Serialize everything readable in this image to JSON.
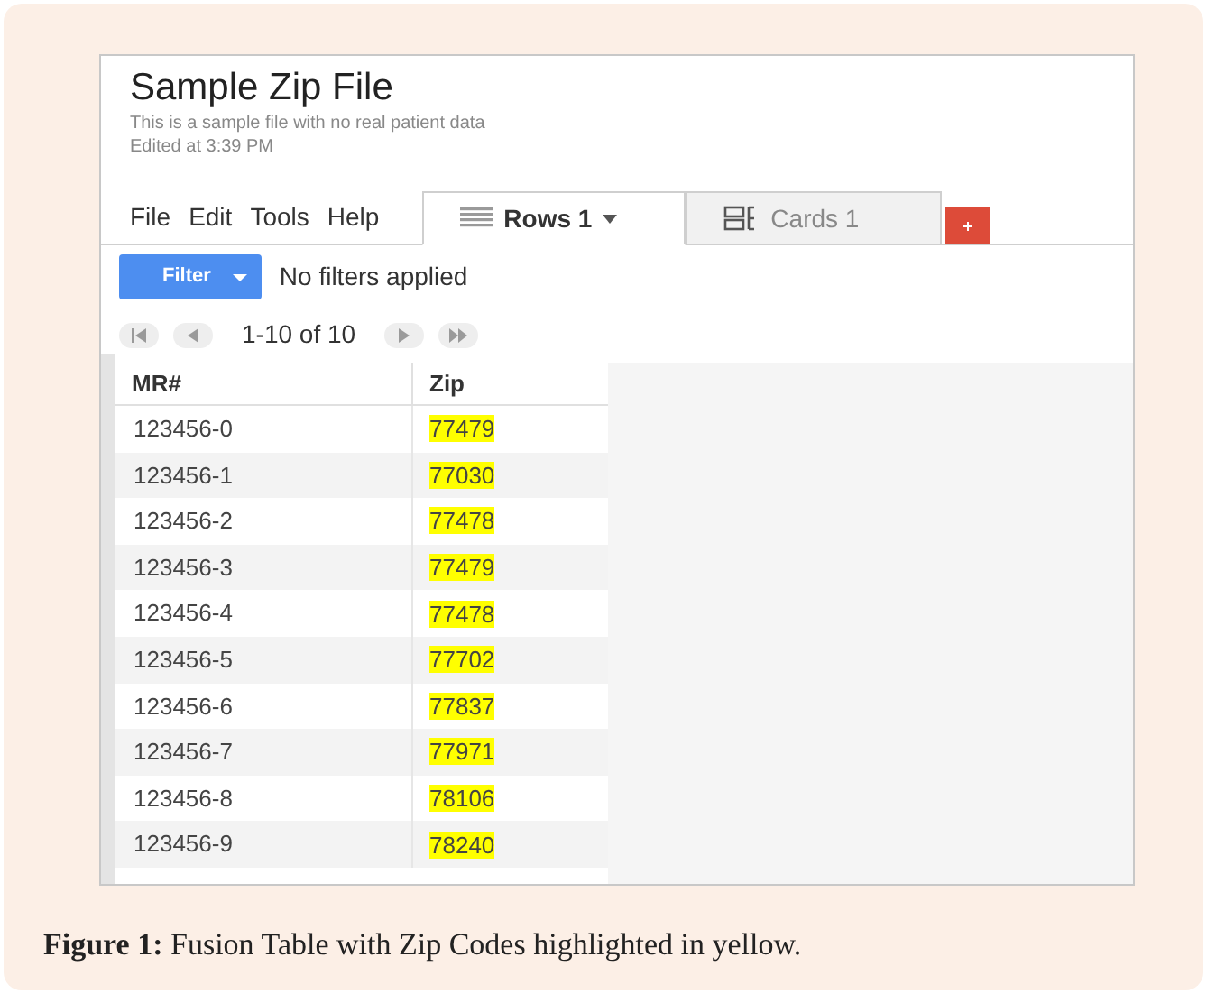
{
  "document": {
    "title": "Sample Zip File",
    "description": "This is a sample file with no real patient data",
    "edited": "Edited at 3:39 PM"
  },
  "menu": [
    "File",
    "Edit",
    "Tools",
    "Help"
  ],
  "tabs": [
    {
      "label": "Rows 1",
      "kind": "rows",
      "selected": true
    },
    {
      "label": "Cards 1",
      "kind": "cards",
      "selected": false
    }
  ],
  "filter": {
    "button": "Filter",
    "status": "No filters applied"
  },
  "pager": {
    "range": "1-10 of 10"
  },
  "table": {
    "columns": [
      "MR#",
      "Zip"
    ],
    "rows": [
      {
        "mr": "123456-0",
        "zip": "77479",
        "highlighted": true
      },
      {
        "mr": "123456-1",
        "zip": "77030",
        "highlighted": true
      },
      {
        "mr": "123456-2",
        "zip": "77478",
        "highlighted": true
      },
      {
        "mr": "123456-3",
        "zip": "77479",
        "highlighted": true
      },
      {
        "mr": "123456-4",
        "zip": "77478",
        "highlighted": true
      },
      {
        "mr": "123456-5",
        "zip": "77702",
        "highlighted": true
      },
      {
        "mr": "123456-6",
        "zip": "77837",
        "highlighted": true
      },
      {
        "mr": "123456-7",
        "zip": "77971",
        "highlighted": true
      },
      {
        "mr": "123456-8",
        "zip": "78106",
        "highlighted": true
      },
      {
        "mr": "123456-9",
        "zip": "78240",
        "highlighted": true
      }
    ]
  },
  "caption": "**Figure 1:** Fusion Table with Zip Codes highlighted in yellow."
}
